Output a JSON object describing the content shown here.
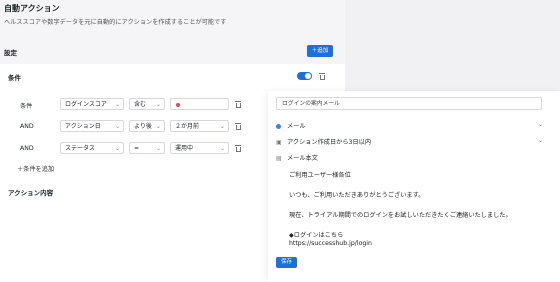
{
  "page": {
    "title": "自動アクション",
    "description": "ヘルススコアや数字データを元に自動的にアクションを作成することが可能です",
    "settings_label": "設定",
    "add_button": "＋追加"
  },
  "condition": {
    "title": "条件",
    "rows": [
      {
        "label": "条件",
        "field": "ログインスコア",
        "operator": "含む",
        "value": ""
      },
      {
        "label": "AND",
        "field": "アクション日",
        "operator": "より後",
        "value": "２か月前"
      },
      {
        "label": "AND",
        "field": "ステータス",
        "operator": "=",
        "value": "運用中"
      }
    ],
    "add_condition": "＋条件を追加",
    "action_content_label": "アクション内容"
  },
  "action": {
    "mail_name": "ログインの案内メール",
    "channel": "メール",
    "schedule": "アクション作成日から3日以内",
    "body_label": "メール本文",
    "body_lines": [
      "ご利用ユーザー様各位",
      "いつも、ご利用いただきありがとうございます。",
      "現在、トライアル期間でのログインをお試しいただきたくご連絡いたしました。",
      "◆ログインはこちら",
      "https://successhub.jp/login"
    ],
    "save_button": "保存"
  },
  "icons": {
    "toggle": "toggle-switch",
    "trash": "trash-icon",
    "chevron": "chevron-down-icon",
    "channel": "globe-icon",
    "calendar": "calendar-icon",
    "document": "document-icon"
  },
  "colors": {
    "accent": "#1b6fe0",
    "status_red": "#e5484d"
  }
}
